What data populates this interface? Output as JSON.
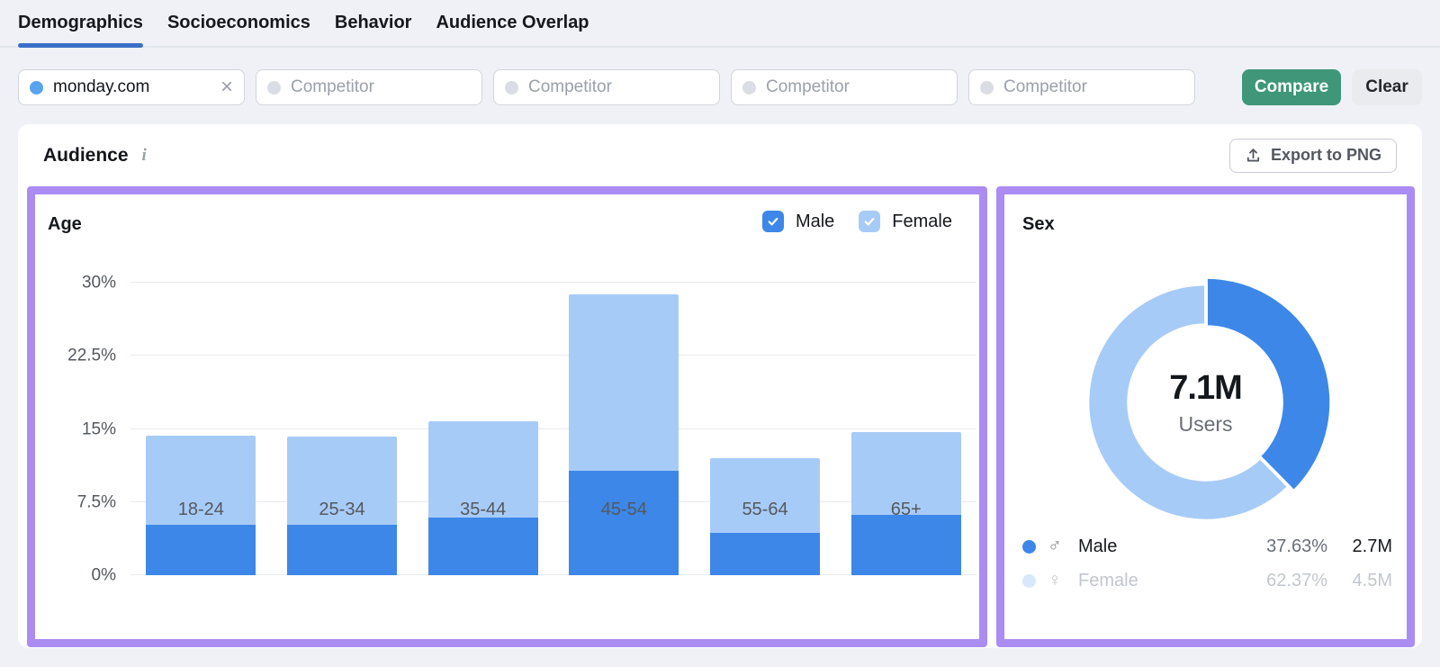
{
  "tabs": [
    {
      "label": "Demographics",
      "active": true
    },
    {
      "label": "Socioeconomics",
      "active": false
    },
    {
      "label": "Behavior",
      "active": false
    },
    {
      "label": "Audience Overlap",
      "active": false
    }
  ],
  "filters": {
    "primary": {
      "value": "monday.com",
      "dot_color": "#58A2F0"
    },
    "competitors": [
      {
        "placeholder": "Competitor"
      },
      {
        "placeholder": "Competitor"
      },
      {
        "placeholder": "Competitor"
      },
      {
        "placeholder": "Competitor"
      }
    ],
    "compare_label": "Compare",
    "clear_label": "Clear",
    "compare_color": "#3F9678"
  },
  "audience": {
    "title": "Audience",
    "info_icon": "i",
    "export_label": "Export to PNG"
  },
  "chart_data": [
    {
      "type": "bar",
      "stacked": true,
      "title": "Age",
      "categories": [
        "18-24",
        "25-34",
        "35-44",
        "45-54",
        "55-64",
        "65+"
      ],
      "series": [
        {
          "name": "Male",
          "color": "#3D87E8",
          "checked": true,
          "values": [
            5.2,
            5.2,
            5.9,
            10.7,
            4.3,
            6.2
          ]
        },
        {
          "name": "Female",
          "color": "#A7CBF7",
          "checked": true,
          "values": [
            9.1,
            9.0,
            9.9,
            18.1,
            7.7,
            8.5
          ]
        }
      ],
      "ylim": [
        0,
        30
      ],
      "yticks": [
        {
          "v": 0,
          "label": "0%"
        },
        {
          "v": 7.5,
          "label": "7.5%"
        },
        {
          "v": 15,
          "label": "15%"
        },
        {
          "v": 22.5,
          "label": "22.5%"
        },
        {
          "v": 30,
          "label": "30%"
        }
      ],
      "grid": true,
      "legend_position": "top-right"
    },
    {
      "type": "pie",
      "donut": true,
      "title": "Sex",
      "center_value": "7.1M",
      "center_label": "Users",
      "slices": [
        {
          "name": "Male",
          "symbol": "♂",
          "pct": 37.63,
          "pct_label": "37.63%",
          "value_label": "2.7M",
          "color": "#3D87E8",
          "dimmed": false
        },
        {
          "name": "Female",
          "symbol": "♀",
          "pct": 62.37,
          "pct_label": "62.37%",
          "value_label": "4.5M",
          "color": "#A7CBF7",
          "dimmed": true,
          "dim_dot_color": "#D7E8FB"
        }
      ],
      "legend_position": "bottom"
    }
  ]
}
